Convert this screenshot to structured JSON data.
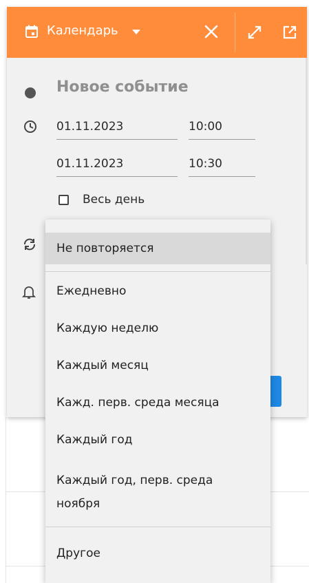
{
  "header": {
    "title": "Календарь",
    "icons": {
      "calendar": "calendar-icon",
      "caret": "caret-down-icon",
      "close": "close-icon",
      "expand": "expand-icon",
      "open_external": "open-external-icon"
    },
    "color": "#ff8c3a"
  },
  "event": {
    "title": "Новое событие",
    "start_date": "01.11.2023",
    "start_time": "10:00",
    "end_date": "01.11.2023",
    "end_time": "10:30",
    "all_day_label": "Весь день",
    "all_day_checked": false
  },
  "repeat_menu": {
    "items": [
      {
        "label": "Не повторяется",
        "selected": true
      },
      {
        "label": "Ежедневно"
      },
      {
        "label": "Каждую неделю"
      },
      {
        "label": "Каждый месяц"
      },
      {
        "label": "Кажд. перв. среда месяца"
      },
      {
        "label": "Каждый год"
      },
      {
        "label": "Каждый год, перв. среда ноября"
      },
      {
        "label": "Другое"
      }
    ]
  },
  "colors": {
    "primary_button": "#1e88e5",
    "dialog_bg": "#f1f1f1",
    "selected_item_bg": "#d9d9d9"
  }
}
